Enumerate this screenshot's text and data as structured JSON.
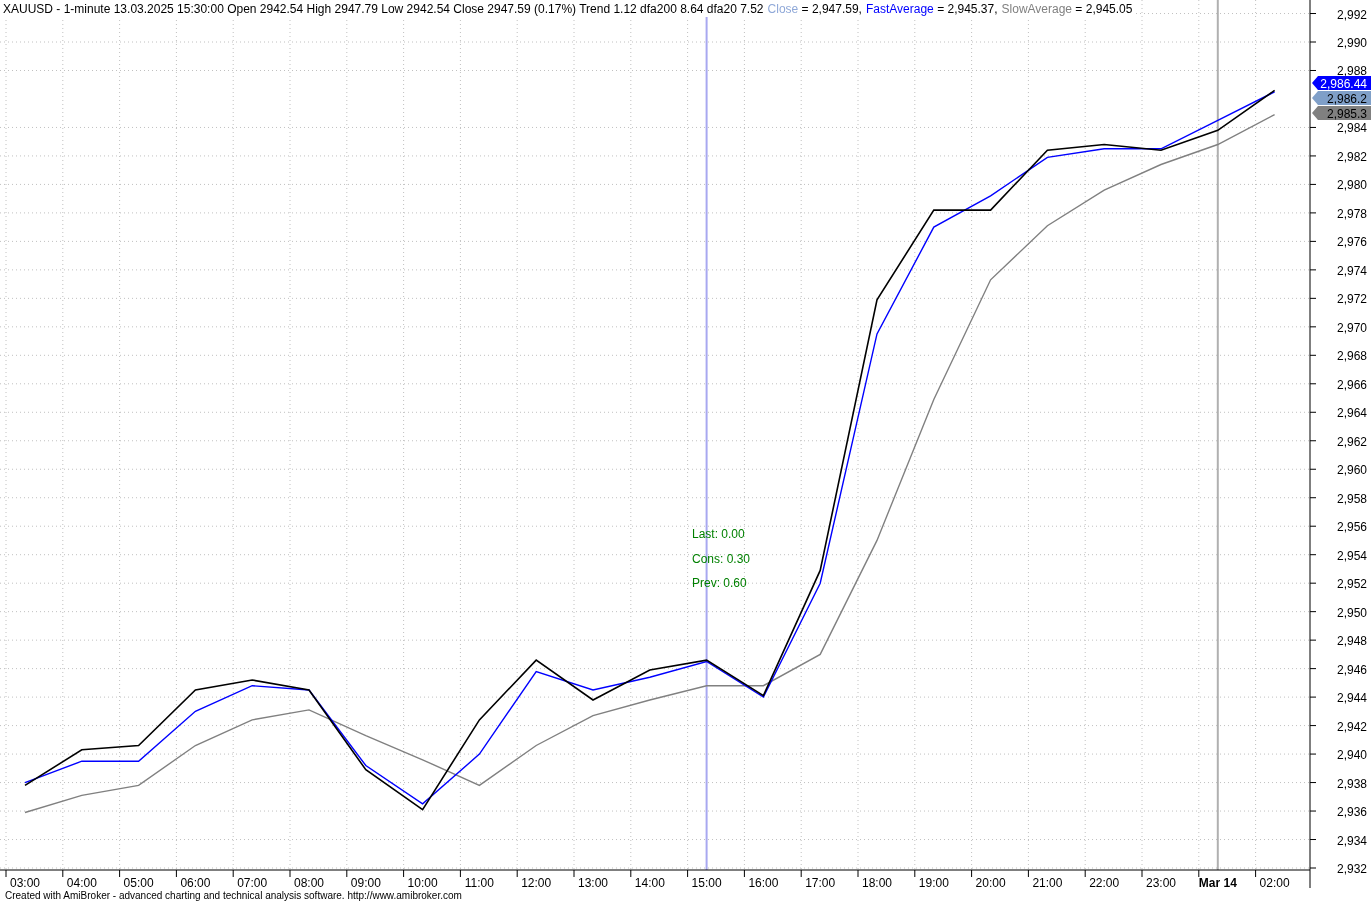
{
  "header": {
    "info": "XAUUSD - 1-minute 13.03.2025 15:30:00 Open 2942.54 High 2947.79 Low 2942.54 Close 2947.59 (0.17%) Trend 1.12 dfa200 8.64 dfa20 7.52",
    "legend": [
      {
        "color": "#8fa8d8",
        "value": " = 2,947.59,"
      },
      {
        "color": "#0000ff",
        "value": " = 2,945.37,"
      },
      {
        "color": "#808080",
        "value": " = 2,945.05"
      }
    ]
  },
  "chart": {
    "chart_data": {
      "type": "line",
      "grid": true,
      "ref_lines": [
        {
          "axis": "x",
          "value": "Mar 14",
          "color": "#b0b0b0"
        },
        {
          "axis": "x",
          "value": "15:00",
          "color": "#a8a8f0"
        }
      ],
      "categories": [
        "03:00",
        "04:00",
        "05:00",
        "06:00",
        "07:00",
        "08:00",
        "09:00",
        "10:00",
        "11:00",
        "12:00",
        "13:00",
        "14:00",
        "15:00",
        "16:00",
        "17:00",
        "18:00",
        "19:00",
        "20:00",
        "21:00",
        "22:00",
        "23:00",
        "Mar 14",
        "02:00"
      ],
      "series": [
        {
          "name": "Close",
          "color": "#000000",
          "values": [
            2937.8,
            2940.3,
            2940.6,
            2944.5,
            2945.2,
            2944.5,
            2938.9,
            2936.1,
            2942.4,
            2946.6,
            2943.8,
            2945.9,
            2946.6,
            2944.1,
            2952.9,
            2971.9,
            2978.2,
            2978.2,
            2982.4,
            2982.8,
            2982.4,
            2983.8,
            2986.6
          ]
        },
        {
          "name": "FastAverage",
          "color": "#0000ff",
          "values": [
            2938.0,
            2939.5,
            2939.5,
            2943.0,
            2944.8,
            2944.5,
            2939.2,
            2936.5,
            2940.0,
            2945.8,
            2944.5,
            2945.4,
            2946.5,
            2944.0,
            2952.0,
            2969.5,
            2977.0,
            2979.2,
            2981.9,
            2982.5,
            2982.5,
            2984.5,
            2986.5
          ]
        },
        {
          "name": "SlowAverage",
          "color": "#808080",
          "values": [
            2935.9,
            2937.1,
            2937.8,
            2940.6,
            2942.4,
            2943.1,
            2941.3,
            2939.6,
            2937.8,
            2940.6,
            2942.7,
            2943.8,
            2944.8,
            2944.8,
            2947.0,
            2955.0,
            2964.9,
            2973.3,
            2977.1,
            2979.6,
            2981.4,
            2982.8,
            2984.9
          ]
        }
      ],
      "ylim": [
        2932,
        2992
      ],
      "yticks": [
        {
          "value": 2932,
          "label": "2,932"
        },
        {
          "value": 2934,
          "label": "2,934"
        },
        {
          "value": 2936,
          "label": "2,936"
        },
        {
          "value": 2938,
          "label": "2,938"
        },
        {
          "value": 2940,
          "label": "2,940"
        },
        {
          "value": 2942,
          "label": "2,942"
        },
        {
          "value": 2944,
          "label": "2,944"
        },
        {
          "value": 2946,
          "label": "2,946"
        },
        {
          "value": 2948,
          "label": "2,948"
        },
        {
          "value": 2950,
          "label": "2,950"
        },
        {
          "value": 2952,
          "label": "2,952"
        },
        {
          "value": 2954,
          "label": "2,954"
        },
        {
          "value": 2956,
          "label": "2,956"
        },
        {
          "value": 2958,
          "label": "2,958"
        },
        {
          "value": 2960,
          "label": "2,960"
        },
        {
          "value": 2962,
          "label": "2,962"
        },
        {
          "value": 2964,
          "label": "2,964"
        },
        {
          "value": 2966,
          "label": "2,966"
        },
        {
          "value": 2968,
          "label": "2,968"
        },
        {
          "value": 2970,
          "label": "2,970"
        },
        {
          "value": 2972,
          "label": "2,972"
        },
        {
          "value": 2974,
          "label": "2,974"
        },
        {
          "value": 2976,
          "label": "2,976"
        },
        {
          "value": 2978,
          "label": "2,978"
        },
        {
          "value": 2980,
          "label": "2,980"
        },
        {
          "value": 2982,
          "label": "2,982"
        },
        {
          "value": 2984,
          "label": "2,984"
        },
        {
          "value": 2988,
          "label": "2,988"
        },
        {
          "value": 2990,
          "label": "2,990"
        },
        {
          "value": 2992,
          "label": "2,992"
        }
      ]
    },
    "indicator_labels": [
      "Last: 0.00",
      "Cons: 0.30",
      "Prev: 0.60"
    ],
    "price_tags": [
      {
        "text": "2,986.44",
        "color": "#0000ff"
      },
      {
        "text": "2,986.2",
        "color": "#7f9fc8"
      },
      {
        "text": "2,985.3",
        "color": "#808080"
      }
    ]
  },
  "footer": "Created with AmiBroker - advanced charting and technical analysis software. http://www.amibroker.com"
}
